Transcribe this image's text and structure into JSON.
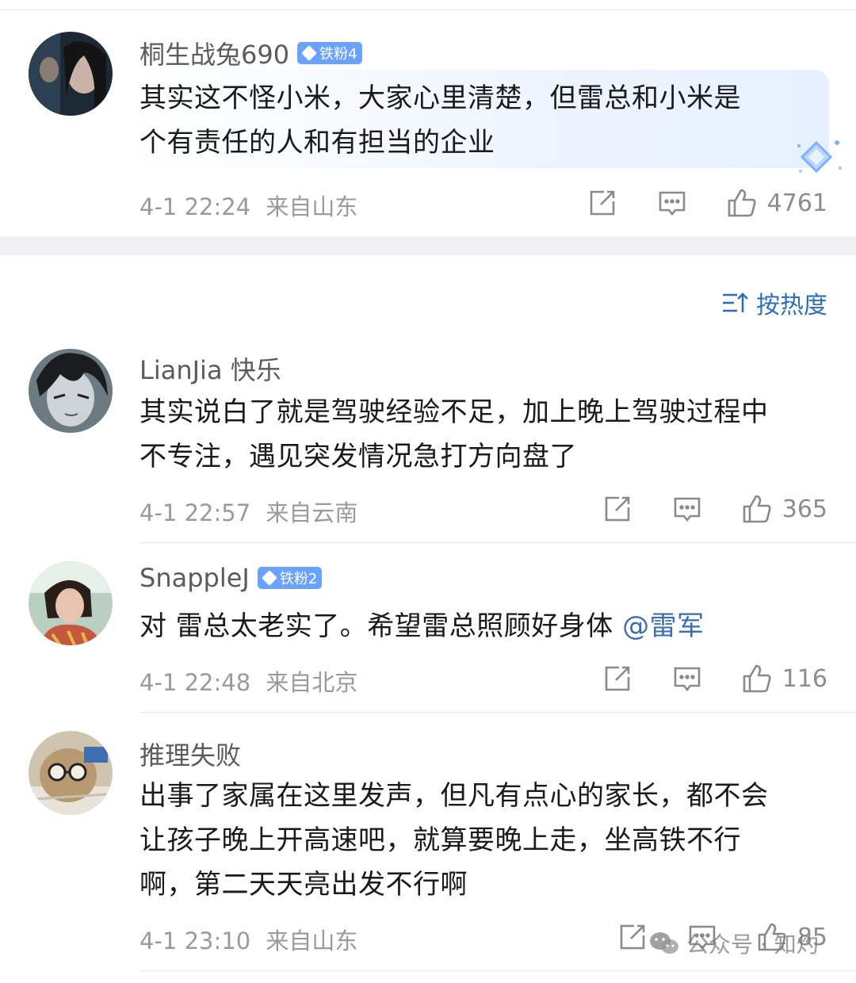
{
  "sort": {
    "label": "按热度"
  },
  "comments": [
    {
      "username": "桐生战兔690",
      "badge": "铁粉4",
      "text_lines": [
        "其实这不怪小米，大家心里清楚，但雷总和小米是",
        "个有责任的人和有担当的企业"
      ],
      "time": "4-1 22:24",
      "location": "来自山东",
      "likes": "4761"
    },
    {
      "username": "LianJia 快乐",
      "text_lines": [
        "其实说白了就是驾驶经验不足，加上晚上驾驶过程中",
        "不专注，遇见突发情况急打方向盘了"
      ],
      "time": "4-1 22:57",
      "location": "来自云南",
      "likes": "365"
    },
    {
      "username": "SnappleJ",
      "badge": "铁粉2",
      "text": "对 雷总太老实了。希望雷总照顾好身体 ",
      "mention": "@雷军",
      "time": "4-1 22:48",
      "location": "来自北京",
      "likes": "116"
    },
    {
      "username": "推理失败",
      "text_lines": [
        "出事了家属在这里发声，但凡有点心的家长，都不会",
        "让孩子晚上开高速吧，就算要晚上走，坐高铁不行",
        "啊，第二天天亮出发不行啊"
      ],
      "time": "4-1 23:10",
      "location": "来自山东",
      "likes": "85"
    }
  ],
  "watermark": "公众号 · 知灼",
  "colors": {
    "link": "#2d6fb8",
    "badge": "#6aa3ff",
    "meta": "#9a9a9a"
  }
}
